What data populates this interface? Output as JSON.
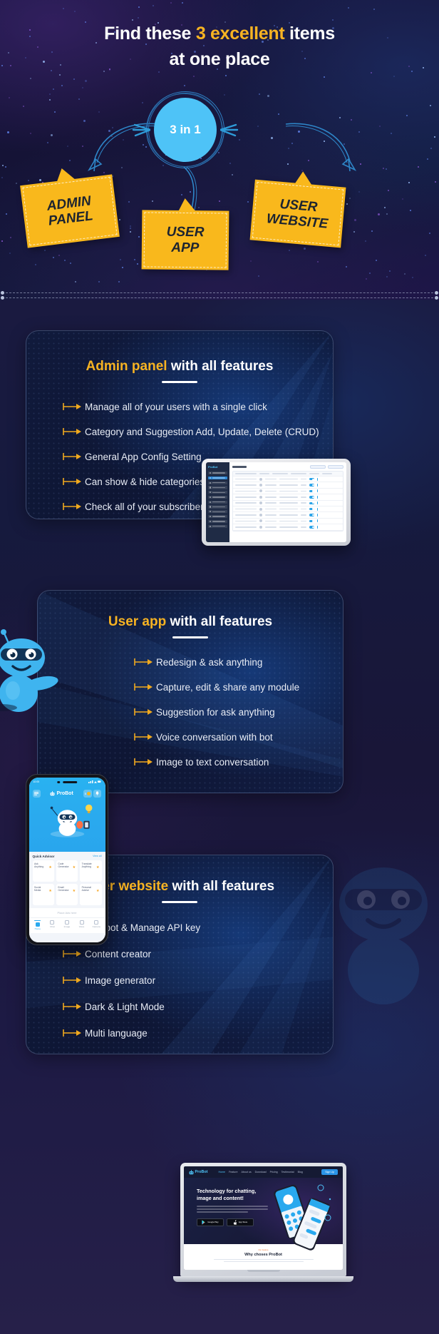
{
  "hero": {
    "title_line1_a": "Find these ",
    "title_line1_hl": "3 excellent",
    "title_line1_b": " items",
    "title_line2": "at one place",
    "badge": "3 in 1",
    "tags": [
      {
        "name": "admin-panel",
        "line1": "ADMIN",
        "line2": "PANEL"
      },
      {
        "name": "user-app",
        "line1": "USER",
        "line2": "APP"
      },
      {
        "name": "user-website",
        "line1": "USER",
        "line2": "WEBSITE"
      }
    ]
  },
  "sections": [
    {
      "id": "admin",
      "title_hl": "Admin panel",
      "title_rest": " with all features",
      "features": [
        "Manage all of your users with a single click",
        "Category and Suggestion Add, Update, Delete (CRUD)",
        "General App Config Setting",
        "Can show & hide categories",
        "Check all of your subscribers"
      ]
    },
    {
      "id": "userapp",
      "title_hl": "User app",
      "title_rest": " with all features",
      "features": [
        "Redesign & ask anything",
        "Capture, edit & share any module",
        "Suggestion for ask anything",
        "Voice conversation with bot",
        "Image to text conversation"
      ]
    },
    {
      "id": "website",
      "title_hl": "User website",
      "title_rest": " with all features",
      "features": [
        "Chatbot & Manage API key",
        "Content creator",
        "Image generator",
        "Dark & Light Mode",
        "Multi language"
      ]
    }
  ],
  "tablet": {
    "app_name": "ProBot",
    "sidebar_items": [
      "Dashboard",
      "Users",
      "Order Archives",
      "Transaction",
      "Subscriber",
      "Categories",
      "Suggestion",
      "Chat Log",
      "Images",
      "App Setting",
      "Language",
      "Logout"
    ],
    "active_item": "Users",
    "page_title": "Users"
  },
  "phone": {
    "status_time": "10:05",
    "app_name": "ProBot",
    "coin_value": "5",
    "quick_advisor_title": "Quick Advisor",
    "quick_advisor_action": "View all",
    "tiles": [
      {
        "line1": "Ask",
        "line2": "Anything"
      },
      {
        "line1": "Code",
        "line2": "Generator"
      },
      {
        "line1": "Translate",
        "line2": "Anything"
      },
      {
        "line1": "Social",
        "line2": "Media"
      },
      {
        "line1": "Email",
        "line2": "Generator"
      },
      {
        "line1": "Personal",
        "line2": "Advise"
      }
    ],
    "ads_placeholder": "Place Ads here",
    "nav": [
      "Home",
      "Chat",
      "Image",
      "Voice",
      "Camera"
    ],
    "nav_active": "Home"
  },
  "laptop": {
    "brand": "ProBot",
    "nav": [
      "Home",
      "Feature",
      "About us",
      "Download",
      "Pricing",
      "Testimonial",
      "Blog"
    ],
    "nav_active": "Home",
    "cta": "Sign Up",
    "hero_title": "Technology for chatting, image and content!",
    "store_badges": [
      "Google Play",
      "App Store"
    ],
    "section_sub": "Our feature",
    "section_title": "Why choses ProBot"
  },
  "colors": {
    "accent_yellow": "#f7b322",
    "accent_blue": "#4ec3f7",
    "tag_yellow": "#f9b81c",
    "text_light": "#e8ecf5"
  }
}
